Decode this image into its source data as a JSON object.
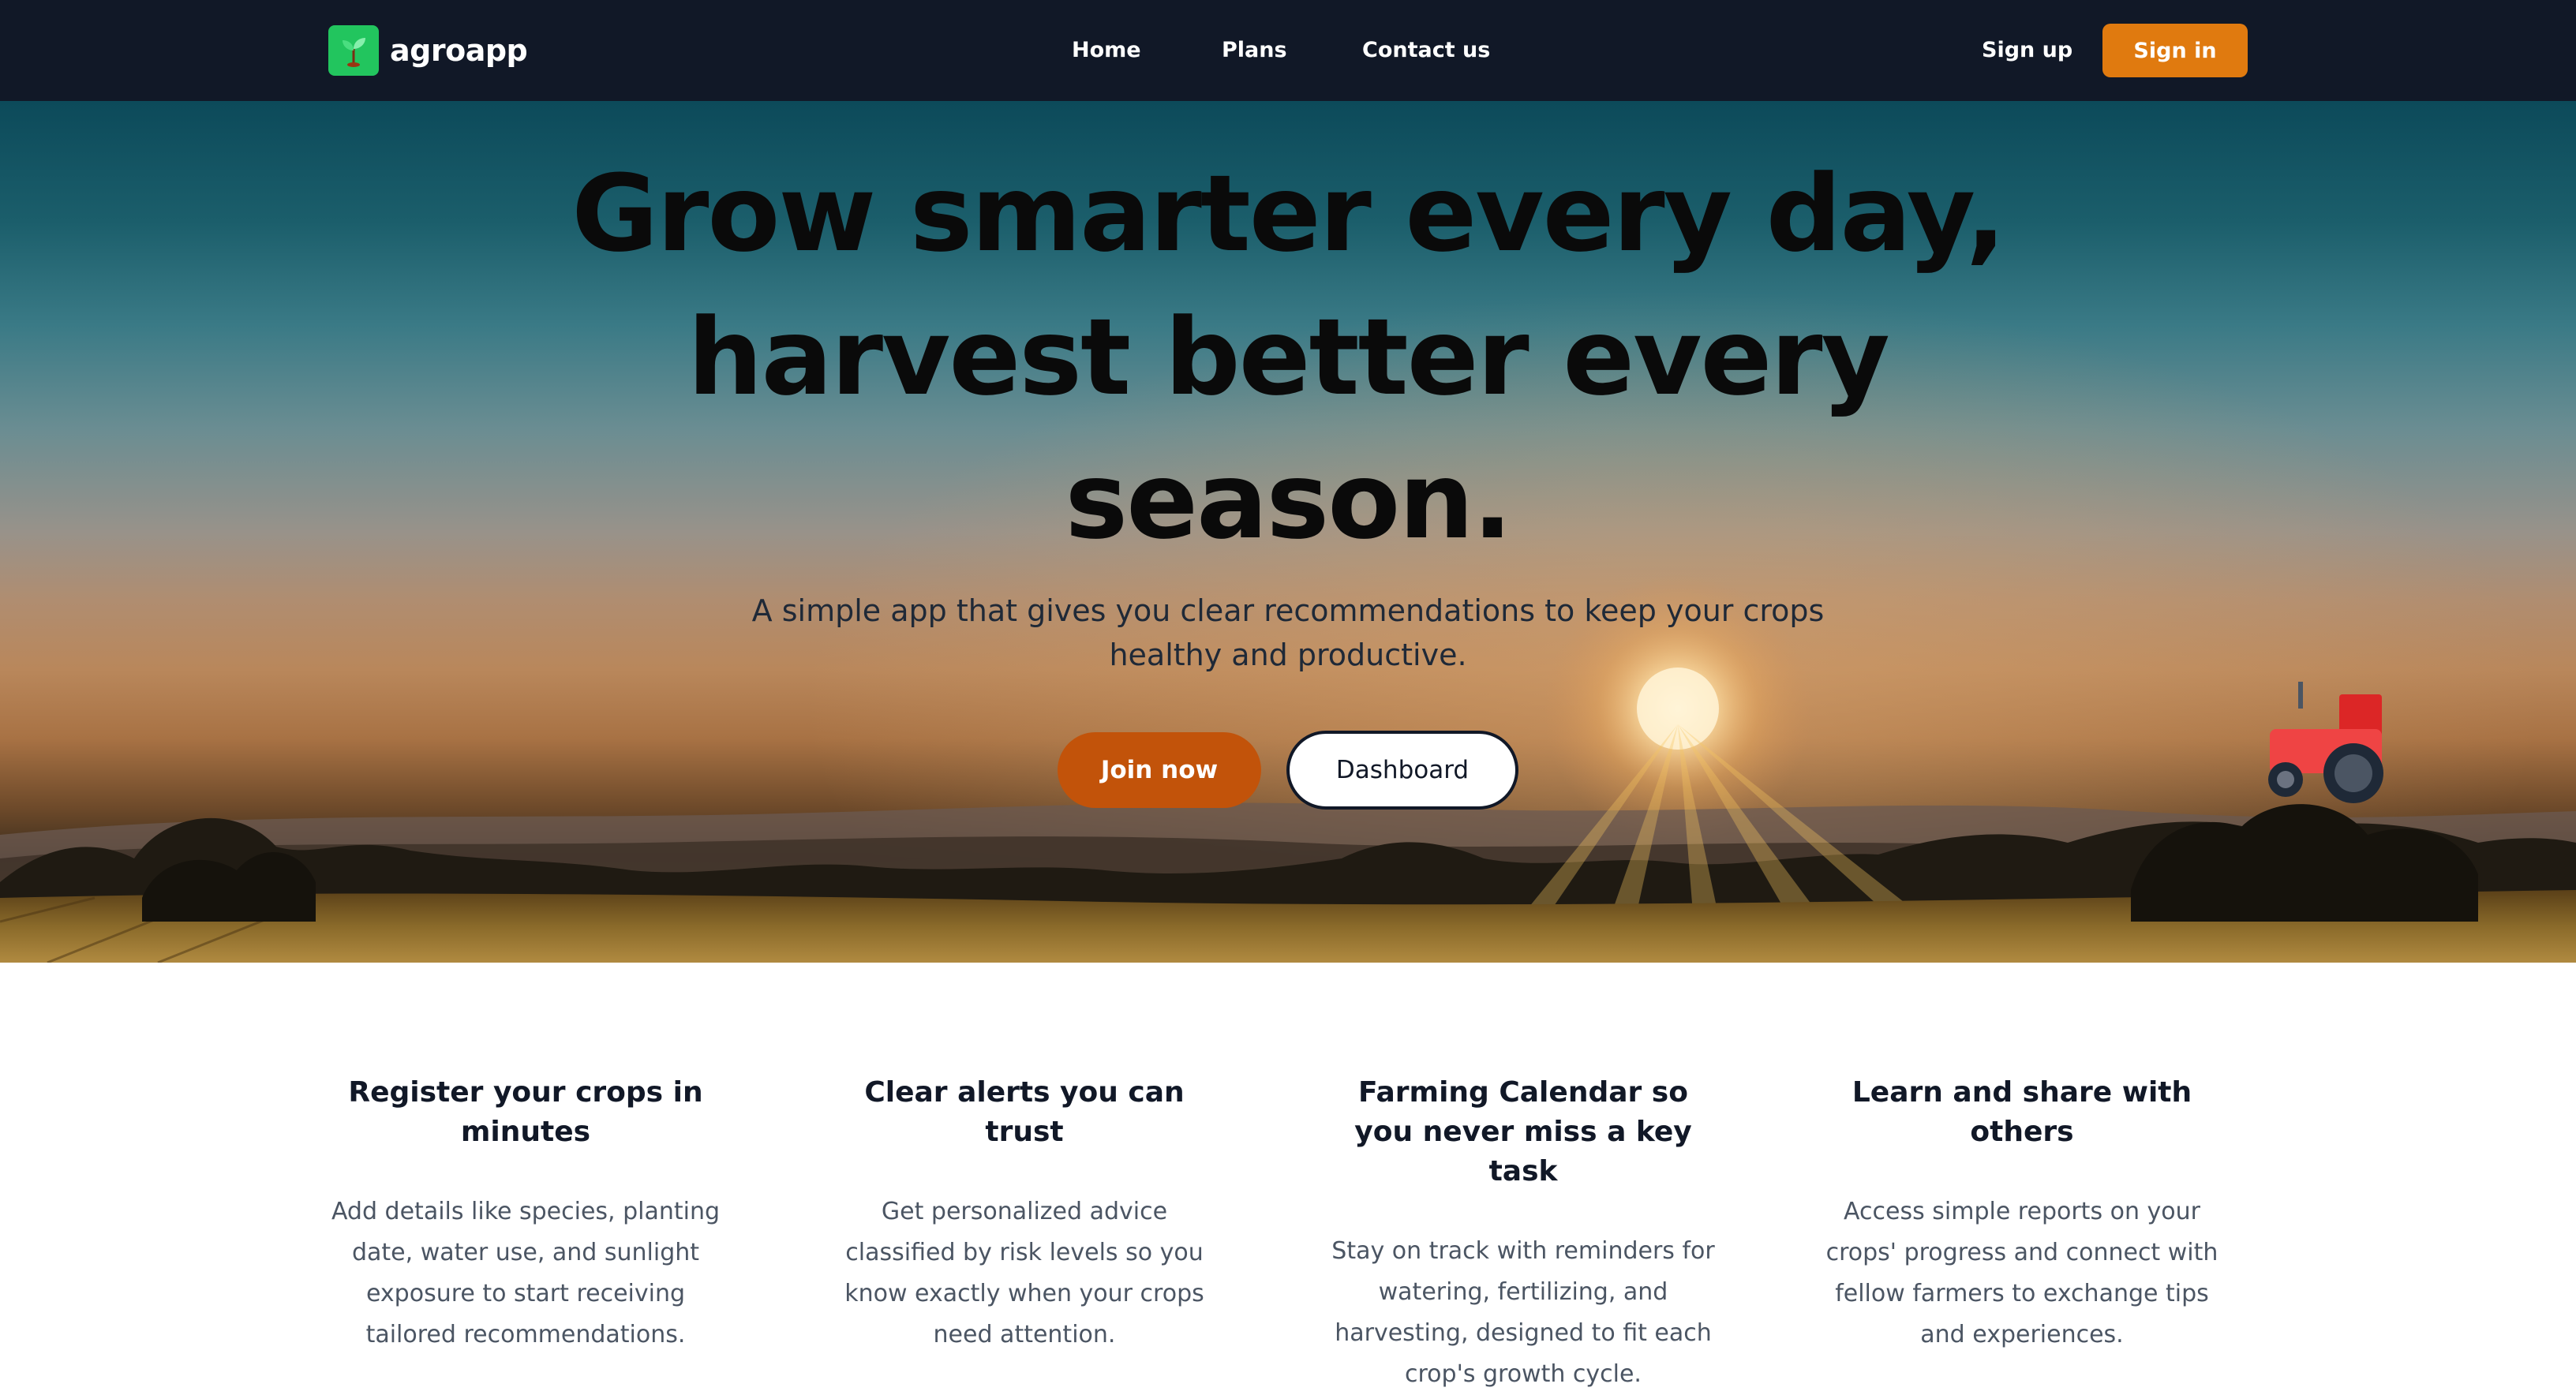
{
  "brand": {
    "name": "agroapp",
    "logo_icon": "seedling-icon",
    "logo_color": "#22c55e"
  },
  "nav": {
    "links": [
      "Home",
      "Plans",
      "Contact us"
    ],
    "signup_label": "Sign up",
    "signin_label": "Sign in",
    "signin_color": "#e07a0f",
    "background": "#111827"
  },
  "hero": {
    "title": "Grow smarter every day, harvest better every season.",
    "subtitle": "A simple app that gives you clear recommendations to keep your crops healthy and productive.",
    "join_label": "Join now",
    "join_color": "#c2530a",
    "dashboard_label": "Dashboard",
    "background_image": "sunset-farmland-landscape",
    "decoration_icon": "tractor-icon"
  },
  "features": [
    {
      "title": "Register your crops in minutes",
      "text": "Add details like species, planting date, water use, and sunlight exposure to start receiving tailored recommendations."
    },
    {
      "title": "Clear alerts you can trust",
      "text": "Get personalized advice classified by risk levels so you know exactly when your crops need attention."
    },
    {
      "title": "Farming Calendar so you never miss a key task",
      "text": "Stay on track with reminders for watering, fertilizing, and harvesting, designed to fit each crop's growth cycle."
    },
    {
      "title": "Learn and share with others",
      "text": "Access simple reports on your crops' progress and connect with fellow farmers to exchange tips and experiences."
    }
  ]
}
